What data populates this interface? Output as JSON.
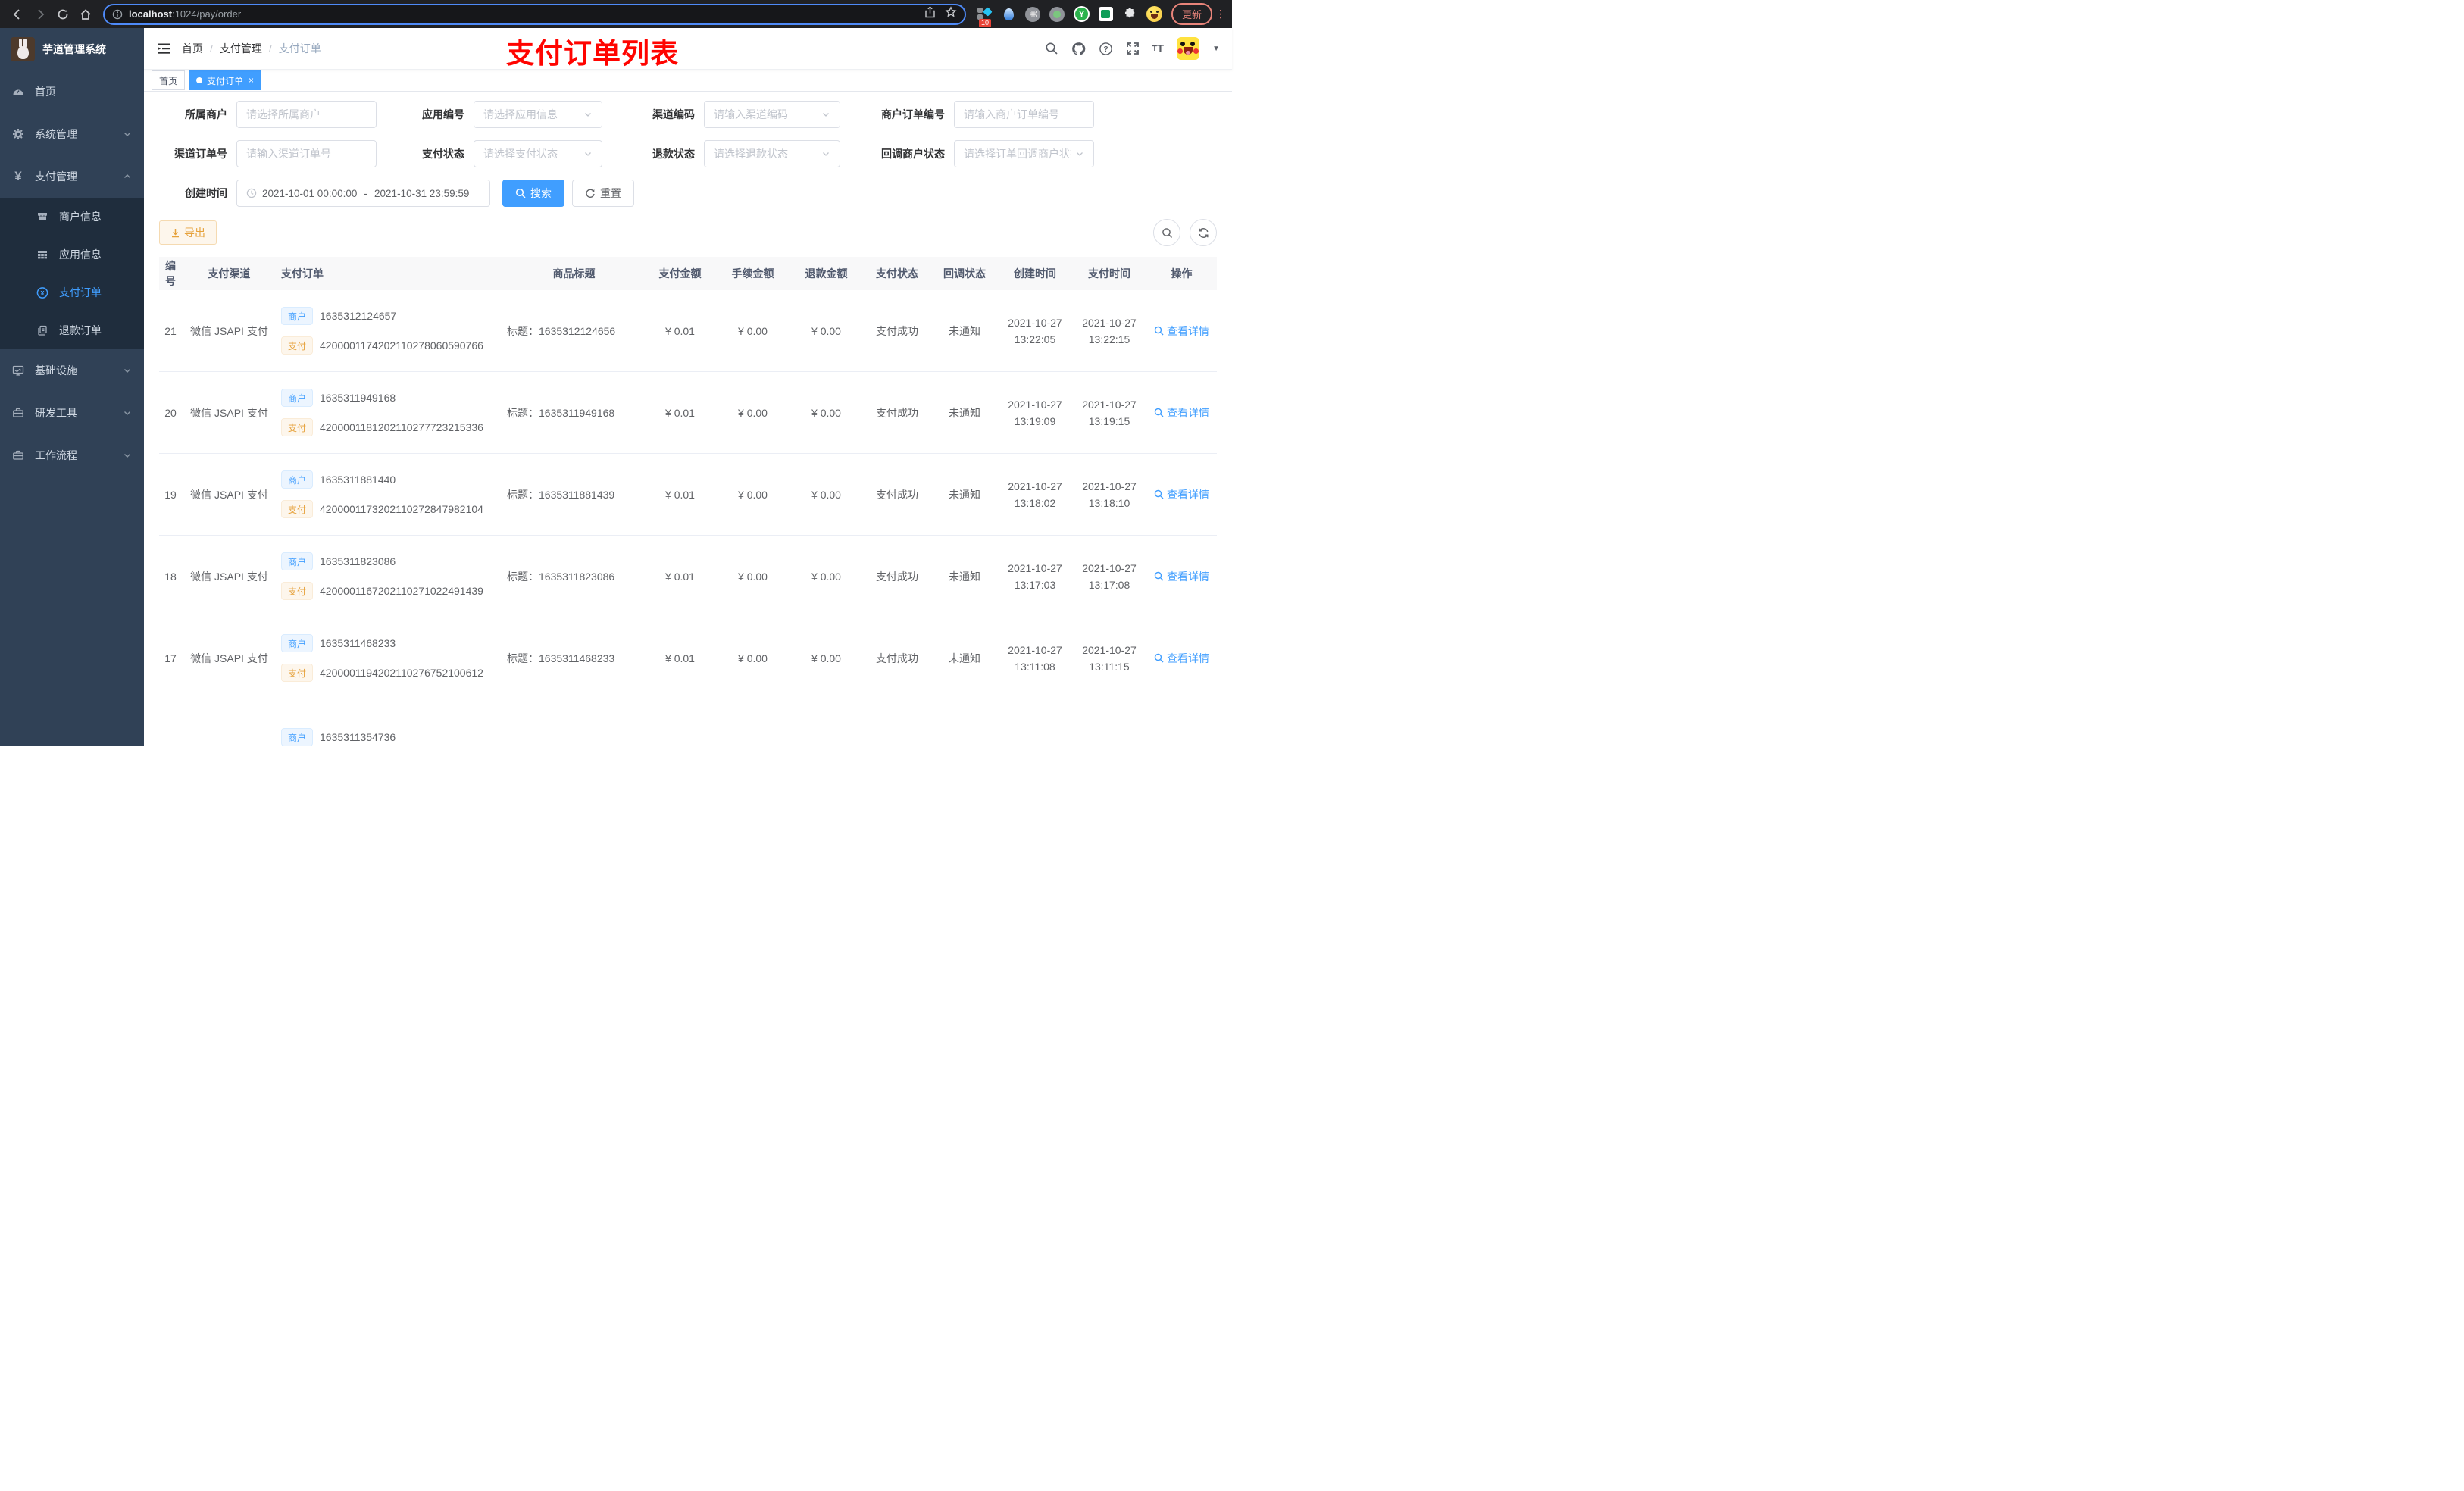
{
  "browser": {
    "url_host": "localhost",
    "url_path": ":1024/pay/order",
    "update_label": "更新",
    "extension_badge": "10",
    "icons": [
      "back-icon",
      "forward-icon",
      "reload-icon",
      "home-icon",
      "info-icon",
      "share-icon",
      "star-icon",
      "extensions",
      "kebab-menu"
    ]
  },
  "sidebar": {
    "app_title": "芋道管理系统",
    "menu": [
      {
        "label": "首页",
        "icon": "dashboard-icon"
      },
      {
        "label": "系统管理",
        "icon": "gear-icon",
        "expandable": true
      },
      {
        "label": "支付管理",
        "icon": "yen-icon",
        "expandable": true,
        "expanded": true
      }
    ],
    "submenu": [
      {
        "label": "商户信息",
        "icon": "store-icon"
      },
      {
        "label": "应用信息",
        "icon": "grid-icon"
      },
      {
        "label": "支付订单",
        "icon": "yen-circle-icon",
        "active": true
      },
      {
        "label": "退款订单",
        "icon": "document-icon"
      }
    ],
    "menu_bottom": [
      {
        "label": "基础设施",
        "icon": "monitor-icon"
      },
      {
        "label": "研发工具",
        "icon": "toolbox-icon"
      },
      {
        "label": "工作流程",
        "icon": "briefcase-icon"
      }
    ]
  },
  "header": {
    "breadcrumb": [
      "首页",
      "支付管理",
      "支付订单"
    ],
    "annotation": "支付订单列表",
    "right_icons": [
      "search-icon",
      "github-icon",
      "question-icon",
      "fullscreen-icon",
      "font-size-icon",
      "avatar",
      "caret-down-icon"
    ]
  },
  "tabs": [
    {
      "label": "首页",
      "active": false
    },
    {
      "label": "支付订单",
      "active": true,
      "close": "×"
    }
  ],
  "filters": {
    "row1": [
      {
        "label": "所属商户",
        "placeholder": "请选择所属商户",
        "type": "input"
      },
      {
        "label": "应用编号",
        "placeholder": "请选择应用信息",
        "type": "select"
      },
      {
        "label": "渠道编码",
        "placeholder": "请输入渠道编码",
        "type": "select"
      },
      {
        "label": "商户订单编号",
        "placeholder": "请输入商户订单编号",
        "type": "input"
      }
    ],
    "row2": [
      {
        "label": "渠道订单号",
        "placeholder": "请输入渠道订单号",
        "type": "input"
      },
      {
        "label": "支付状态",
        "placeholder": "请选择支付状态",
        "type": "select"
      },
      {
        "label": "退款状态",
        "placeholder": "请选择退款状态",
        "type": "select"
      },
      {
        "label": "回调商户状态",
        "placeholder": "请选择订单回调商户状态",
        "type": "select"
      }
    ],
    "date_label": "创建时间",
    "date_start": "2021-10-01 00:00:00",
    "date_separator": "-",
    "date_end": "2021-10-31 23:59:59",
    "search_label": "搜索",
    "reset_label": "重置"
  },
  "toolbar": {
    "export_label": "导出"
  },
  "table": {
    "columns": [
      "编号",
      "支付渠道",
      "支付订单",
      "商品标题",
      "支付金额",
      "手续金额",
      "退款金额",
      "支付状态",
      "回调状态",
      "创建时间",
      "支付时间",
      "操作"
    ],
    "merchant_tag": "商户",
    "pay_tag": "支付",
    "action_label": "查看详情",
    "rows": [
      {
        "id": "21",
        "channel": "微信 JSAPI 支付",
        "merchant_no": "1635312124657",
        "pay_no": "4200001174202110278060590766",
        "title": "标题：1635312124656",
        "pay_amount": "¥ 0.01",
        "fee_amount": "¥ 0.00",
        "refund_amount": "¥ 0.00",
        "pay_status": "支付成功",
        "notify_status": "未通知",
        "create_date": "2021-10-27",
        "create_time": "13:22:05",
        "pay_date": "2021-10-27",
        "pay_time": "13:22:15"
      },
      {
        "id": "20",
        "channel": "微信 JSAPI 支付",
        "merchant_no": "1635311949168",
        "pay_no": "4200001181202110277723215336",
        "title": "标题：1635311949168",
        "pay_amount": "¥ 0.01",
        "fee_amount": "¥ 0.00",
        "refund_amount": "¥ 0.00",
        "pay_status": "支付成功",
        "notify_status": "未通知",
        "create_date": "2021-10-27",
        "create_time": "13:19:09",
        "pay_date": "2021-10-27",
        "pay_time": "13:19:15"
      },
      {
        "id": "19",
        "channel": "微信 JSAPI 支付",
        "merchant_no": "1635311881440",
        "pay_no": "4200001173202110272847982104",
        "title": "标题：1635311881439",
        "pay_amount": "¥ 0.01",
        "fee_amount": "¥ 0.00",
        "refund_amount": "¥ 0.00",
        "pay_status": "支付成功",
        "notify_status": "未通知",
        "create_date": "2021-10-27",
        "create_time": "13:18:02",
        "pay_date": "2021-10-27",
        "pay_time": "13:18:10"
      },
      {
        "id": "18",
        "channel": "微信 JSAPI 支付",
        "merchant_no": "1635311823086",
        "pay_no": "4200001167202110271022491439",
        "title": "标题：1635311823086",
        "pay_amount": "¥ 0.01",
        "fee_amount": "¥ 0.00",
        "refund_amount": "¥ 0.00",
        "pay_status": "支付成功",
        "notify_status": "未通知",
        "create_date": "2021-10-27",
        "create_time": "13:17:03",
        "pay_date": "2021-10-27",
        "pay_time": "13:17:08"
      },
      {
        "id": "17",
        "channel": "微信 JSAPI 支付",
        "merchant_no": "1635311468233",
        "pay_no": "4200001194202110276752100612",
        "title": "标题：1635311468233",
        "pay_amount": "¥ 0.01",
        "fee_amount": "¥ 0.00",
        "refund_amount": "¥ 0.00",
        "pay_status": "支付成功",
        "notify_status": "未通知",
        "create_date": "2021-10-27",
        "create_time": "13:11:08",
        "pay_date": "2021-10-27",
        "pay_time": "13:11:15"
      },
      {
        "id": "",
        "channel": "",
        "merchant_no": "1635311354736",
        "pay_no": "",
        "title": "",
        "pay_amount": "",
        "fee_amount": "",
        "refund_amount": "",
        "pay_status": "",
        "notify_status": "",
        "create_date": "",
        "create_time": "",
        "pay_date": "",
        "pay_time": "",
        "partial": true
      }
    ]
  },
  "colors": {
    "accent_blue": "#409eff",
    "warning_orange": "#e6a23c",
    "annotation_red": "#ff0400",
    "sidebar_bg": "#304156",
    "submenu_bg": "#1f2d3d",
    "active_tab_bg": "#409eff"
  }
}
